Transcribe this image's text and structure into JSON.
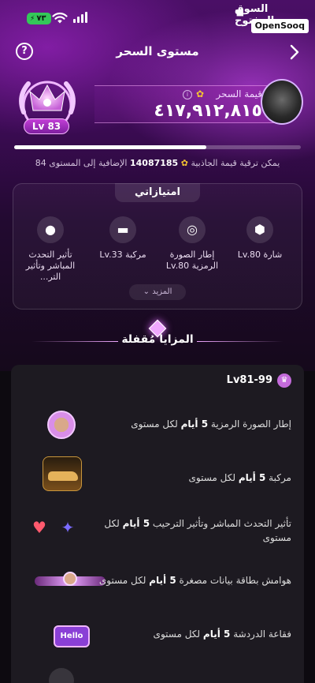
{
  "status": {
    "battery": "٧٣",
    "watermark_ar": "السوق المفتوح",
    "watermark_en": "OpenSooq"
  },
  "header": {
    "title": "مستوى السحر"
  },
  "level": {
    "badge": "Lv 83",
    "value_label": "قيمة السحر",
    "value_number": "٤١٧,٩١٢,٨١٥",
    "progress_fraction": 0.67,
    "upgrade_prefix": "يمكن ترقية قيمة الجاذبية",
    "upgrade_amount": "14087185",
    "upgrade_suffix": "الإضافية إلى المستوى 84"
  },
  "privileges": {
    "title": "امتيازاتي",
    "items": [
      {
        "icon": "badge-icon",
        "label": "شارة Lv.80"
      },
      {
        "icon": "avatar-frame-icon",
        "label": "إطار الصورة الرمزية Lv.80"
      },
      {
        "icon": "car-icon",
        "label": "مركبة Lv.33"
      },
      {
        "icon": "microphone-icon",
        "label": "تأثير التحدث المباشر وتأثير التر..."
      }
    ],
    "more_label": "المزيد"
  },
  "locked": {
    "title": "المزايا مُقفلة",
    "range": "Lv81-99",
    "perks": [
      {
        "icon": "avatar-frame-thumb",
        "text_prefix": "إطار الصورة الرمزية",
        "duration": "5 أيام",
        "text_suffix": "لكل مستوى"
      },
      {
        "icon": "car-thumb",
        "text_prefix": "مركبة",
        "duration": "5 أيام",
        "text_suffix": "لكل مستوى"
      },
      {
        "icon": "entry-effect-thumb",
        "text_prefix": "تأثير التحدث المباشر وتأثير الترحيب",
        "duration": "5 أيام",
        "text_suffix": "لكل مستوى"
      },
      {
        "icon": "card-border-thumb",
        "text_prefix": "هوامش بطاقة بيانات مصغرة",
        "duration": "5 أيام",
        "text_suffix": "لكل مستوى"
      },
      {
        "icon": "chat-bubble-thumb",
        "text_prefix": "فقاعة الدردشة",
        "duration": "5 أيام",
        "text_suffix": "لكل مستوى",
        "thumb_label": "Hello"
      }
    ]
  },
  "colors": {
    "accent": "#c33fd6",
    "background": "#0d0a10",
    "card": "#1d1a21"
  }
}
